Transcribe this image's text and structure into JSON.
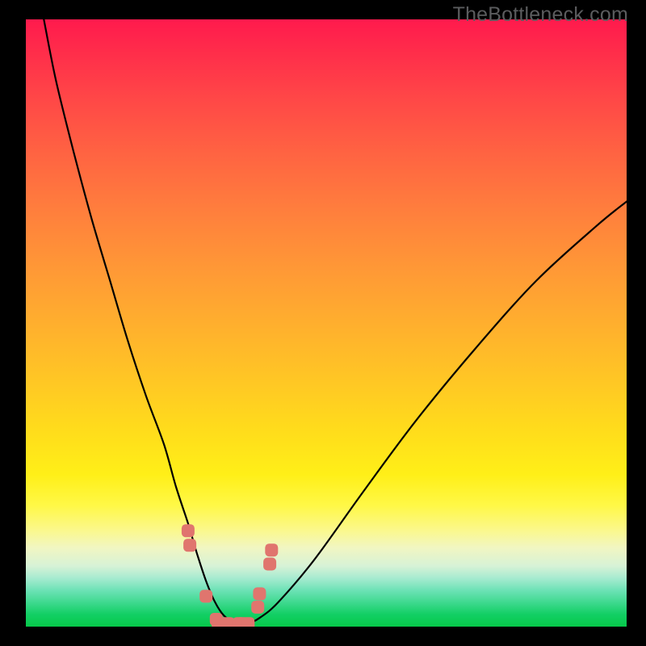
{
  "watermark": "TheBottleneck.com",
  "chart_data": {
    "type": "line",
    "title": "",
    "xlabel": "",
    "ylabel": "",
    "xlim": [
      0,
      100
    ],
    "ylim": [
      0,
      100
    ],
    "grid": false,
    "legend": false,
    "series": [
      {
        "name": "bottleneck-curve",
        "x": [
          3,
          5,
          8,
          11,
          14,
          17,
          20,
          23,
          25,
          27,
          28.5,
          30,
          31.5,
          33,
          35,
          37,
          39,
          42,
          48,
          56,
          65,
          75,
          85,
          95,
          100
        ],
        "y": [
          100,
          90,
          78,
          67,
          57,
          47,
          38,
          30,
          23,
          17,
          12,
          7.5,
          4,
          1.8,
          0.5,
          0.5,
          1.5,
          4,
          11,
          22,
          34,
          46,
          57,
          66,
          70
        ]
      }
    ],
    "markers": {
      "name": "highlight-points",
      "color": "#e0756e",
      "x": [
        27.0,
        27.3,
        30.0,
        31.7,
        32.0,
        32.7,
        33.7,
        35.5,
        36.0,
        37.0,
        38.6,
        38.9,
        40.6,
        40.9
      ],
      "y": [
        15.8,
        13.4,
        5.0,
        1.2,
        0.6,
        0.5,
        0.5,
        0.5,
        0.5,
        0.5,
        3.2,
        5.4,
        10.3,
        12.6
      ]
    },
    "gradient_stops": [
      {
        "pos": 0,
        "color": "#ff1a4d"
      },
      {
        "pos": 50,
        "color": "#ffb12d"
      },
      {
        "pos": 75,
        "color": "#ffef18"
      },
      {
        "pos": 100,
        "color": "#07c94a"
      }
    ]
  }
}
